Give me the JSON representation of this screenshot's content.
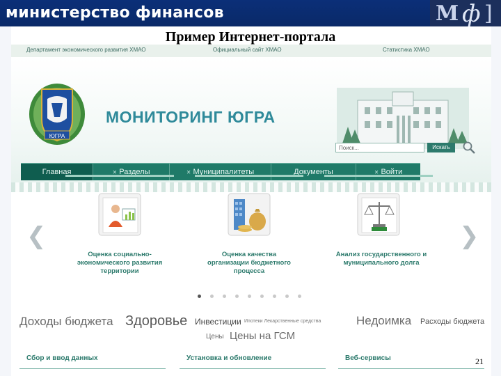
{
  "slide": {
    "ministry": "министерство финансов",
    "logo": {
      "part1": "М",
      "part2": "ф",
      "part3": "]"
    },
    "title": "Пример Интернет-портала",
    "page_number": "21"
  },
  "portal": {
    "toplinks": [
      "Департамент экономического развития ХМАО",
      "Официальный сайт ХМАО",
      "Статистика ХМАО"
    ],
    "title": "МОНИТОРИНГ ЮГРА",
    "emblem_label": "ЮГРА",
    "search": {
      "placeholder": "Поиск...",
      "button": "Искать"
    },
    "nav": [
      "Главная",
      "Разделы",
      "Муниципалитеты",
      "Документы",
      "Войти"
    ],
    "cards": [
      {
        "label_1": "Оценка социально-",
        "label_2": "экономического развития",
        "label_3": "территории"
      },
      {
        "label_1": "Оценка качества",
        "label_2": "организации бюджетного",
        "label_3": "процесса"
      },
      {
        "label_1": "Анализ государственного и",
        "label_2": "муниципального долга",
        "label_3": ""
      }
    ],
    "tags": [
      "Доходы бюджета",
      "Здоровье",
      "Инвестиции",
      "Ипотеки Лекарственные средства",
      "Недоимка",
      "Расходы бюджета",
      "Цены",
      "Цены на ГСМ"
    ],
    "bottom": [
      "Сбор и ввод данных",
      "Установка и обновление",
      "Веб-сервисы"
    ],
    "carousel_dots": 9,
    "carousel_active": 1
  }
}
